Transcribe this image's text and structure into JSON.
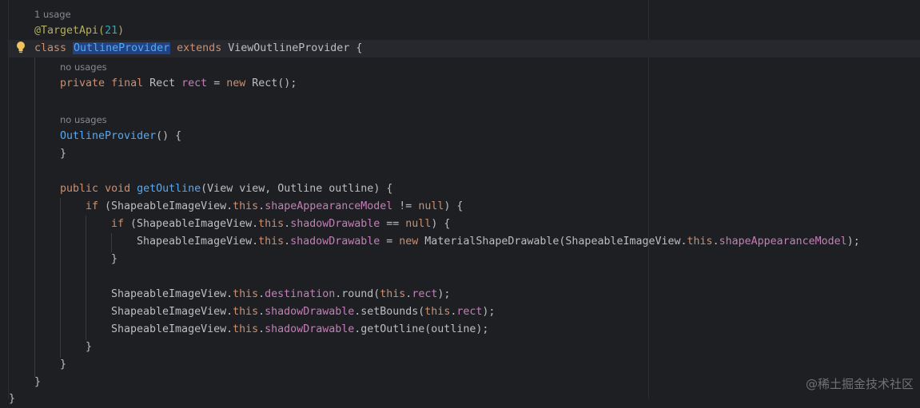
{
  "hints": {
    "usage_count": "1 usage",
    "no_usages_rect": "no usages",
    "no_usages_ctor": "no usages"
  },
  "code": {
    "l1_annotation": "@TargetApi(",
    "l1_number": "21",
    "l1_close": ")",
    "l2_class": "class",
    "l2_name": "OutlineProvider",
    "l2_extends": "extends",
    "l2_parent": "ViewOutlineProvider {",
    "l3_private": "private",
    "l3_final": "final",
    "l3_type": "Rect",
    "l3_field": "rect",
    "l3_eq": "=",
    "l3_new": "new",
    "l3_rest": "Rect();",
    "l4_ctor": "OutlineProvider",
    "l4_rest": "() {",
    "l5_close": "}",
    "l6_public": "public",
    "l6_void": "void",
    "l6_method": "getOutline",
    "l6_params": "(View view, Outline outline) {",
    "l7_if": "if",
    "l7_a": "(ShapeableImageView.",
    "l7_this": "this",
    "l7_dot": ".",
    "l7_field": "shapeAppearanceModel",
    "l7_op": " != ",
    "l7_null": "null",
    "l7_end": ") {",
    "l8_if": "if",
    "l8_a": "(ShapeableImageView.",
    "l8_this": "this",
    "l8_dot": ".",
    "l8_field": "shadowDrawable",
    "l8_op": " == ",
    "l8_null": "null",
    "l8_end": ") {",
    "l9_a": "ShapeableImageView.",
    "l9_this": "this",
    "l9_dot": ".",
    "l9_field": "shadowDrawable",
    "l9_eq": " = ",
    "l9_new": "new",
    "l9_b": " MaterialShapeDrawable(ShapeableImageView.",
    "l9_this2": "this",
    "l9_dot2": ".",
    "l9_field2": "shapeAppearanceModel",
    "l9_end": ");",
    "l10_close": "}",
    "l11_a": "ShapeableImageView.",
    "l11_this": "this",
    "l11_dot": ".",
    "l11_field": "destination",
    "l11_b": ".round(",
    "l11_this2": "this",
    "l11_dot2": ".",
    "l11_field2": "rect",
    "l11_end": ");",
    "l12_a": "ShapeableImageView.",
    "l12_this": "this",
    "l12_dot": ".",
    "l12_field": "shadowDrawable",
    "l12_b": ".setBounds(",
    "l12_this2": "this",
    "l12_dot2": ".",
    "l12_field2": "rect",
    "l12_end": ");",
    "l13_a": "ShapeableImageView.",
    "l13_this": "this",
    "l13_dot": ".",
    "l13_field": "shadowDrawable",
    "l13_b": ".getOutline(outline);",
    "l14_close": "}",
    "l15_close": "}",
    "l16_close": "}",
    "l17_close": "}"
  },
  "watermark": "@稀土掘金技术社区",
  "icons": {
    "bulb": "lightbulb-icon"
  },
  "colors": {
    "background": "#1e1f22",
    "keyword": "#cf8e6d",
    "annotation": "#b3ae60",
    "number": "#2aacb8",
    "field": "#c77dbb",
    "function": "#56a8f5",
    "selection": "#214283"
  }
}
